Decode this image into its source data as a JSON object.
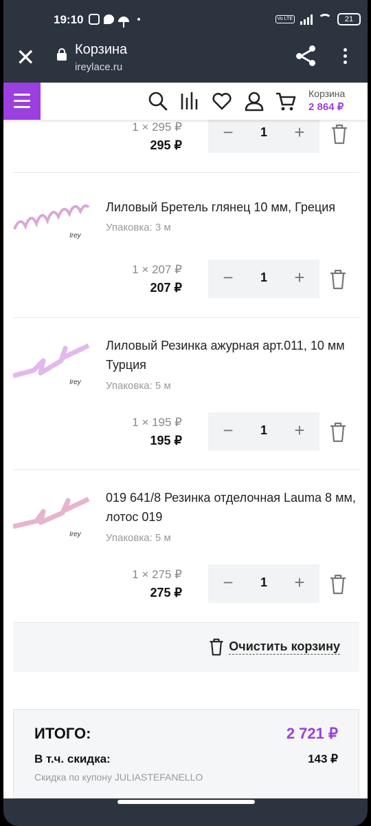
{
  "status": {
    "time": "19:10",
    "volte": "Vo LTE",
    "battery": "21"
  },
  "browser": {
    "title": "Корзина",
    "url": "ireylace.ru"
  },
  "header": {
    "cart_label": "Корзина",
    "cart_total": "2 864 ₽"
  },
  "items": [
    {
      "unit_price": "1 × 295 ₽",
      "sum": "295 ₽",
      "qty": "1"
    },
    {
      "name": "Лиловый Бретель глянец 10 мм, Греция",
      "pack": "Упаковка: 3 м",
      "unit_price": "1 × 207 ₽",
      "sum": "207 ₽",
      "qty": "1"
    },
    {
      "name": "Лиловый Резинка ажурная арт.011, 10 мм Турция",
      "pack": "Упаковка: 5 м",
      "unit_price": "1 × 195 ₽",
      "sum": "195 ₽",
      "qty": "1"
    },
    {
      "name": "019 641/8 Резинка отделочная Lauma 8 мм, лотос 019",
      "pack": "Упаковка: 5 м",
      "unit_price": "1 × 275 ₽",
      "sum": "275 ₽",
      "qty": "1"
    }
  ],
  "qty_controls": {
    "minus": "−",
    "plus": "+"
  },
  "clear_cart": "Очистить корзину",
  "summary": {
    "total_label": "ИТОГО:",
    "total_value": "2 721 ₽",
    "discount_label": "В т.ч. скидка:",
    "discount_value": "143 ₽",
    "coupon_text": "Скидка по купону JULIASTEFANELLO"
  },
  "colors": {
    "accent": "#9b3fe0",
    "topbar": "#2c3440"
  }
}
